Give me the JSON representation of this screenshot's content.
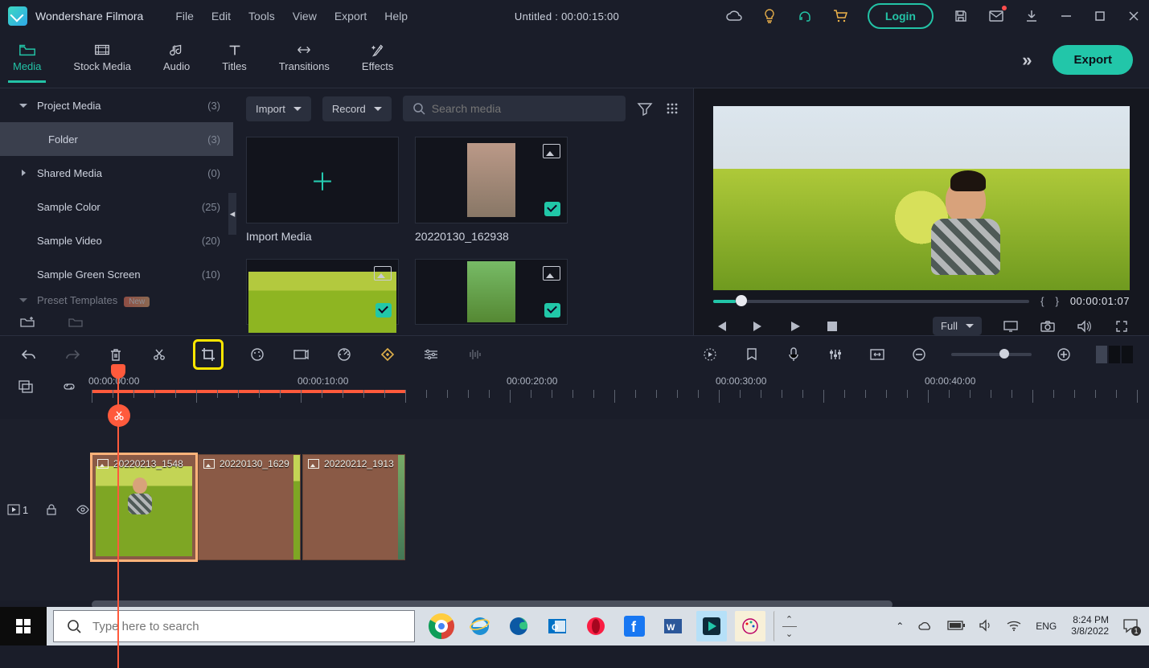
{
  "app": {
    "name": "Wondershare Filmora",
    "doc_title": "Untitled : 00:00:15:00",
    "login": "Login"
  },
  "menu": {
    "file": "File",
    "edit": "Edit",
    "tools": "Tools",
    "view": "View",
    "export": "Export",
    "help": "Help"
  },
  "ribbon": {
    "media": "Media",
    "stock": "Stock Media",
    "audio": "Audio",
    "titles": "Titles",
    "transitions": "Transitions",
    "effects": "Effects",
    "export_btn": "Export"
  },
  "sidebar": {
    "items": [
      {
        "label": "Project Media",
        "count": "(3)"
      },
      {
        "label": "Folder",
        "count": "(3)"
      },
      {
        "label": "Shared Media",
        "count": "(0)"
      },
      {
        "label": "Sample Color",
        "count": "(25)"
      },
      {
        "label": "Sample Video",
        "count": "(20)"
      },
      {
        "label": "Sample Green Screen",
        "count": "(10)"
      },
      {
        "label": "Preset Templates",
        "count": ""
      }
    ],
    "new_badge": "New"
  },
  "media_toolbar": {
    "import": "Import",
    "record": "Record",
    "search_placeholder": "Search media"
  },
  "media": {
    "items": [
      {
        "title": "Import Media"
      },
      {
        "title": "20220130_162938"
      },
      {
        "title": ""
      },
      {
        "title": ""
      }
    ]
  },
  "preview": {
    "timecode": "00:00:01:07",
    "mark_in": "{",
    "mark_out": "}",
    "quality": "Full"
  },
  "ruler": {
    "labels": [
      "00:00:00:00",
      "00:00:10:00",
      "00:00:20:00",
      "00:00:30:00",
      "00:00:40:00"
    ]
  },
  "clips": [
    {
      "name": "20220213_1548"
    },
    {
      "name": "20220130_1629"
    },
    {
      "name": "20220212_1913"
    }
  ],
  "track": {
    "label": "1"
  },
  "taskbar": {
    "search_placeholder": "Type here to search",
    "lang": "ENG",
    "time": "8:24 PM",
    "date": "3/8/2022"
  }
}
